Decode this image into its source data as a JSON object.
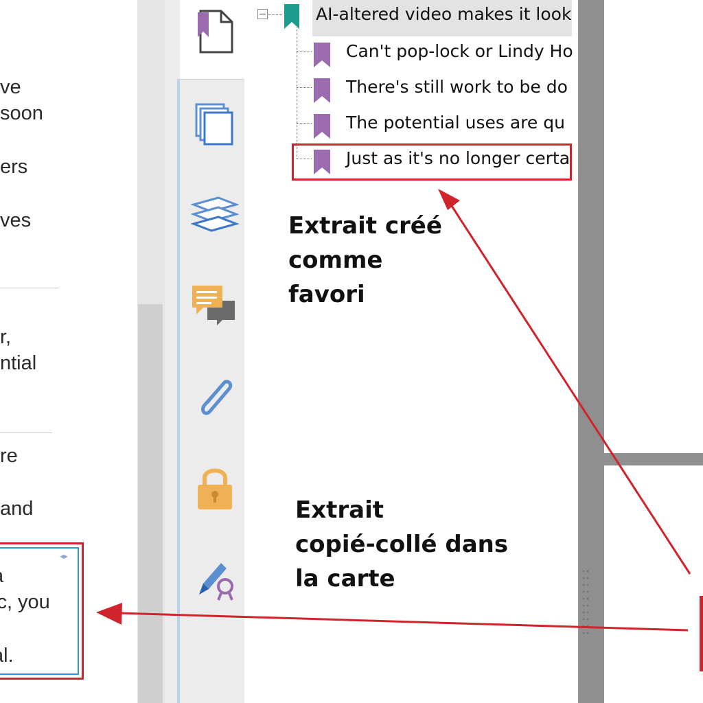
{
  "document": {
    "lines": [
      {
        "text": "ve"
      },
      {
        "text": "soon"
      },
      {
        "text": "ers"
      },
      {
        "text": "ves"
      },
      {
        "text": "r,"
      },
      {
        "text": "ntial"
      },
      {
        "text": "re"
      },
      {
        "text": "and"
      }
    ],
    "card_lines": [
      {
        "text": "a"
      },
      {
        "text": "ic, you"
      },
      {
        "text": "al."
      }
    ],
    "card_handle": "◂▸"
  },
  "tabs": [
    {
      "icon": "page-icon"
    },
    {
      "icon": "pages-icon"
    },
    {
      "icon": "layers-icon"
    },
    {
      "icon": "comments-icon"
    },
    {
      "icon": "paperclip-icon"
    },
    {
      "icon": "lock-icon"
    },
    {
      "icon": "signature-icon"
    }
  ],
  "bookmarks": {
    "root": {
      "label": "AI-altered video makes it look"
    },
    "children": [
      {
        "label": "Can't pop-lock or Lindy Ho"
      },
      {
        "label": "There's still work to be do"
      },
      {
        "label": "The potential uses are qu"
      },
      {
        "label": "Just as it's no longer certa"
      }
    ]
  },
  "annotations": {
    "top": [
      "Extrait créé",
      "comme",
      "favori"
    ],
    "bottom": [
      "Extrait",
      "copié-collé dans",
      "la carte"
    ]
  },
  "colors": {
    "annotation_red": "#d0232b",
    "bookmark_purple": "#9b6bb0",
    "bookmark_teal": "#1e9a8e",
    "tab_blue": "#5b8fd0",
    "tab_orange": "#f0b155"
  }
}
